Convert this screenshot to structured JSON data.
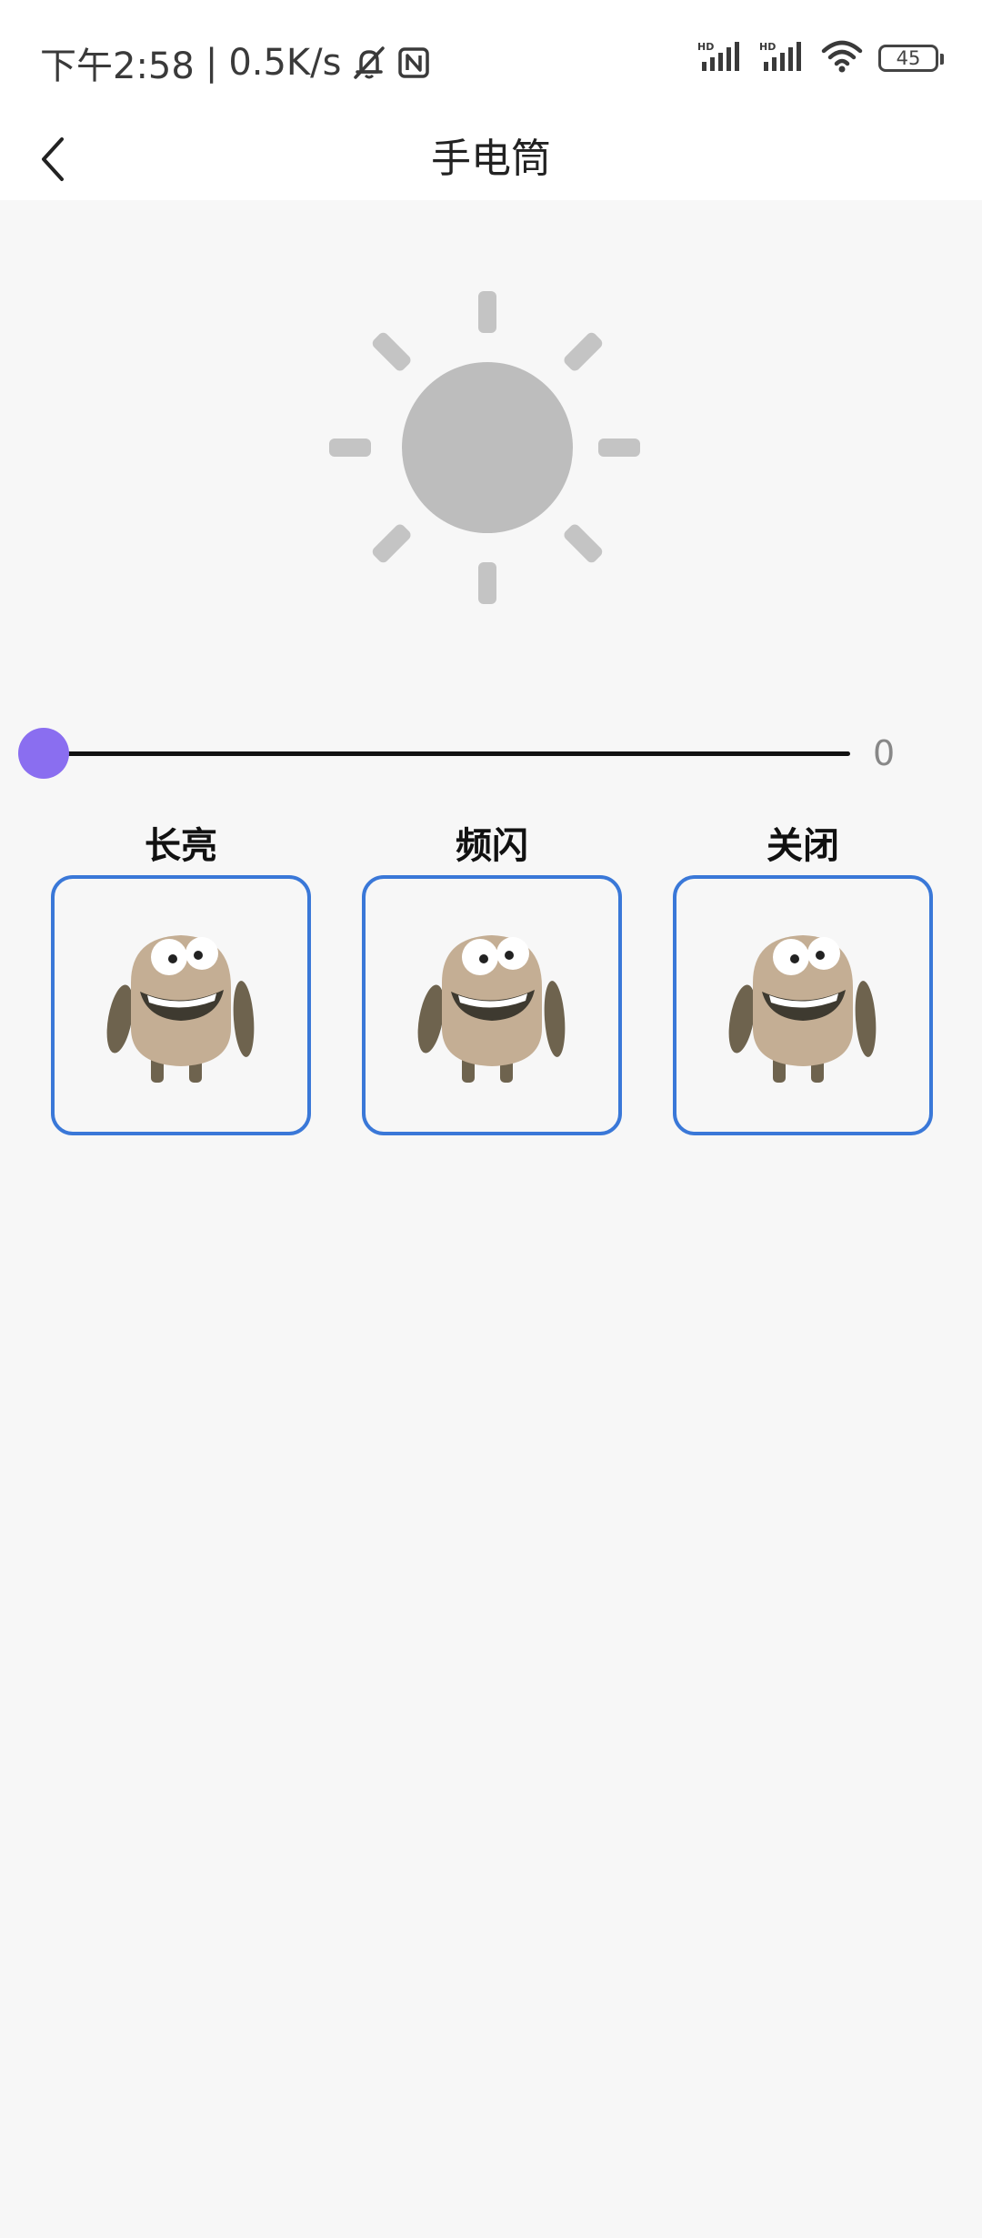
{
  "status_bar": {
    "time": "下午2:58",
    "separator": "|",
    "network_speed": "0.5K/s",
    "icons": [
      "mute-icon",
      "nfc-icon",
      "hd-signal-icon",
      "hd-signal-icon",
      "wifi-icon"
    ],
    "battery": "45"
  },
  "nav": {
    "back_icon": "chevron-left-icon",
    "title": "手电筒"
  },
  "sun": {
    "icon": "sun-icon",
    "color": "#bdbdbd"
  },
  "brightness": {
    "value": "0",
    "level": 0,
    "thumb_color": "#8a6ef0"
  },
  "modes": [
    {
      "label": "长亮",
      "icon": "monster-icon"
    },
    {
      "label": "频闪",
      "icon": "monster-icon"
    },
    {
      "label": "关闭",
      "icon": "monster-icon"
    }
  ],
  "colors": {
    "card_border": "#3a78d8",
    "background": "#f7f7f7"
  }
}
